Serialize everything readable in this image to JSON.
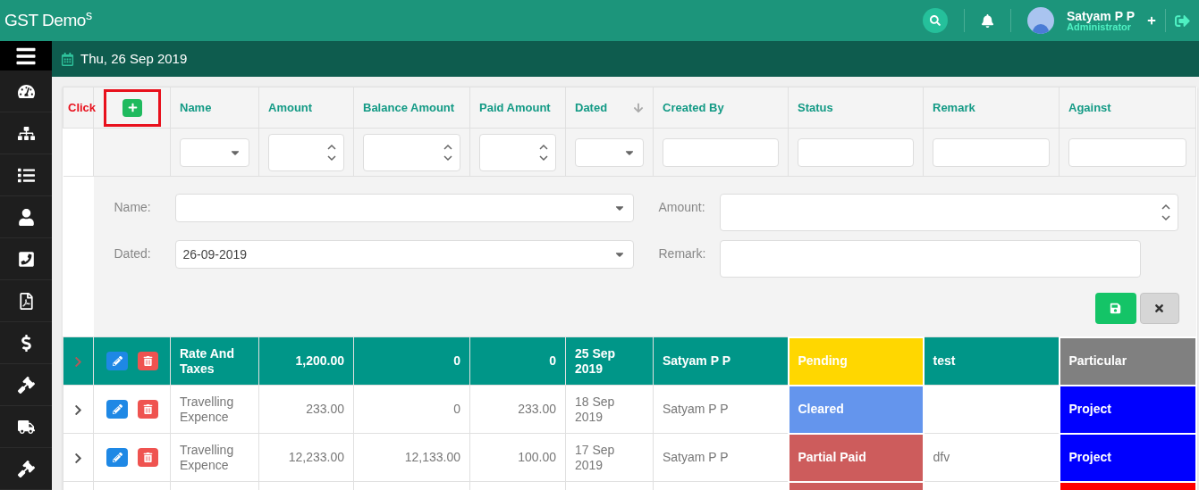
{
  "app": {
    "title": "GST Demo$^{s}$"
  },
  "user": {
    "name": "Satyam P P",
    "role": "Administrator"
  },
  "date_bar": {
    "date": "Thu, 26 Sep 2019"
  },
  "sidebar": {
    "items": [
      {
        "kind": "gauge"
      },
      {
        "kind": "sitemap"
      },
      {
        "kind": "list"
      },
      {
        "kind": "user"
      },
      {
        "kind": "phone"
      },
      {
        "kind": "pdf"
      },
      {
        "kind": "dollar"
      },
      {
        "kind": "gavel"
      },
      {
        "kind": "truck"
      },
      {
        "kind": "gavel"
      }
    ]
  },
  "table": {
    "hint": "Click",
    "columns": [
      {
        "label": "Name",
        "sorted": false,
        "filter": {
          "kind": "select"
        }
      },
      {
        "label": "Amount",
        "sorted": false,
        "filter": {
          "kind": "number"
        }
      },
      {
        "label": "Balance Amount",
        "sorted": false,
        "filter": {
          "kind": "number"
        }
      },
      {
        "label": "Paid Amount",
        "sorted": false,
        "filter": {
          "kind": "number"
        }
      },
      {
        "label": "Dated",
        "sorted": true,
        "filter": {
          "kind": "select"
        }
      },
      {
        "label": "Created By",
        "sorted": false,
        "filter": {
          "kind": "text"
        }
      },
      {
        "label": "Status",
        "sorted": false,
        "filter": {
          "kind": "text"
        }
      },
      {
        "label": "Remark",
        "sorted": false,
        "filter": {
          "kind": "text"
        }
      },
      {
        "label": "Against",
        "sorted": false,
        "filter": {
          "kind": "text"
        }
      }
    ],
    "form": {
      "fields": [
        {
          "label": "Name:",
          "kind": "select"
        },
        {
          "label": "Amount:",
          "kind": "number"
        },
        {
          "label": "Dated:",
          "kind": "select",
          "value": "26-09-2019"
        },
        {
          "label": "Remark:",
          "kind": "textarea"
        }
      ]
    },
    "rows": [
      {
        "selected": true,
        "name": "Rate And Taxes",
        "amount": "1,200.00",
        "balance": "0",
        "paid": "0",
        "dated": "25 Sep 2019",
        "created_by": "Satyam P P",
        "status": {
          "label": "Pending",
          "color": "#ffd700"
        },
        "remark": "test",
        "against": {
          "label": "Particular",
          "color": "#808080"
        }
      },
      {
        "selected": false,
        "name": "Travelling Expence",
        "amount": "233.00",
        "balance": "0",
        "paid": "233.00",
        "dated": "18 Sep 2019",
        "created_by": "Satyam P P",
        "status": {
          "label": "Cleared",
          "color": "#6495ed"
        },
        "against": {
          "label": "Project",
          "color": "#0000ff"
        }
      },
      {
        "selected": false,
        "name": "Travelling Expence",
        "amount": "12,233.00",
        "balance": "12,133.00",
        "paid": "100.00",
        "dated": "17 Sep 2019",
        "created_by": "Satyam P P",
        "status": {
          "label": "Partial Paid",
          "color": "#cd5c5c"
        },
        "remark": "dfv",
        "against": {
          "label": "Project",
          "color": "#0000ff"
        }
      },
      {
        "selected": false,
        "status": {
          "color": "#cd5c5c"
        },
        "against": {
          "color": "#ff0000"
        }
      }
    ]
  }
}
